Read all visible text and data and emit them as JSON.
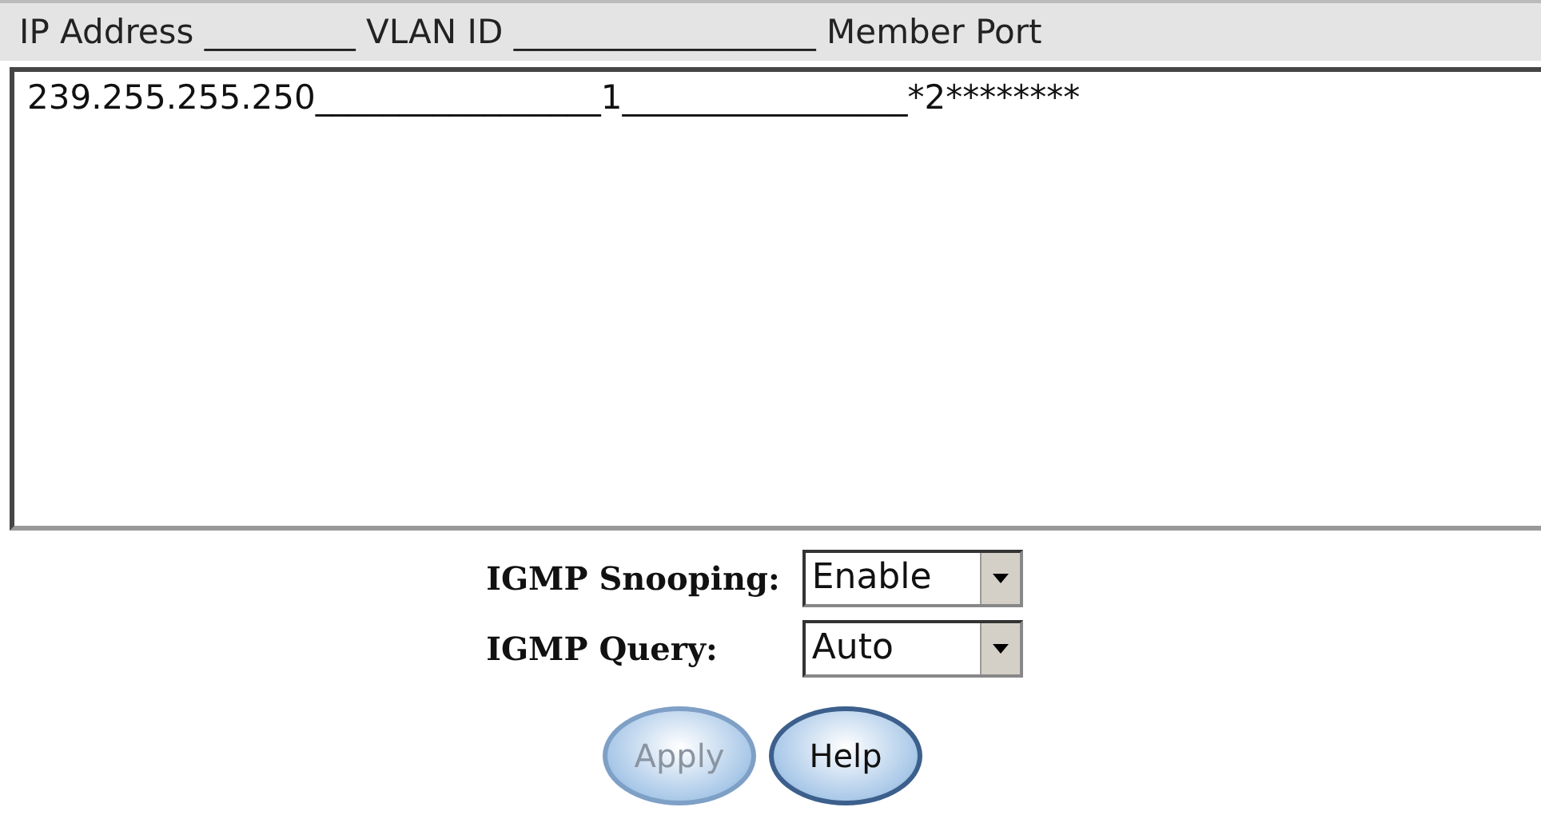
{
  "list_header": "IP Address _________ VLAN ID __________________ Member Port",
  "list_items": [
    {
      "text": "239.255.255.250_________________1_________________*2********",
      "selected": false
    }
  ],
  "settings": [
    {
      "label": "IGMP Snooping:",
      "value": "Enable"
    },
    {
      "label": "IGMP Query:",
      "value": "Auto"
    }
  ],
  "buttons": [
    {
      "label": "Apply",
      "disabled": true
    },
    {
      "label": "Help",
      "disabled": false
    }
  ]
}
